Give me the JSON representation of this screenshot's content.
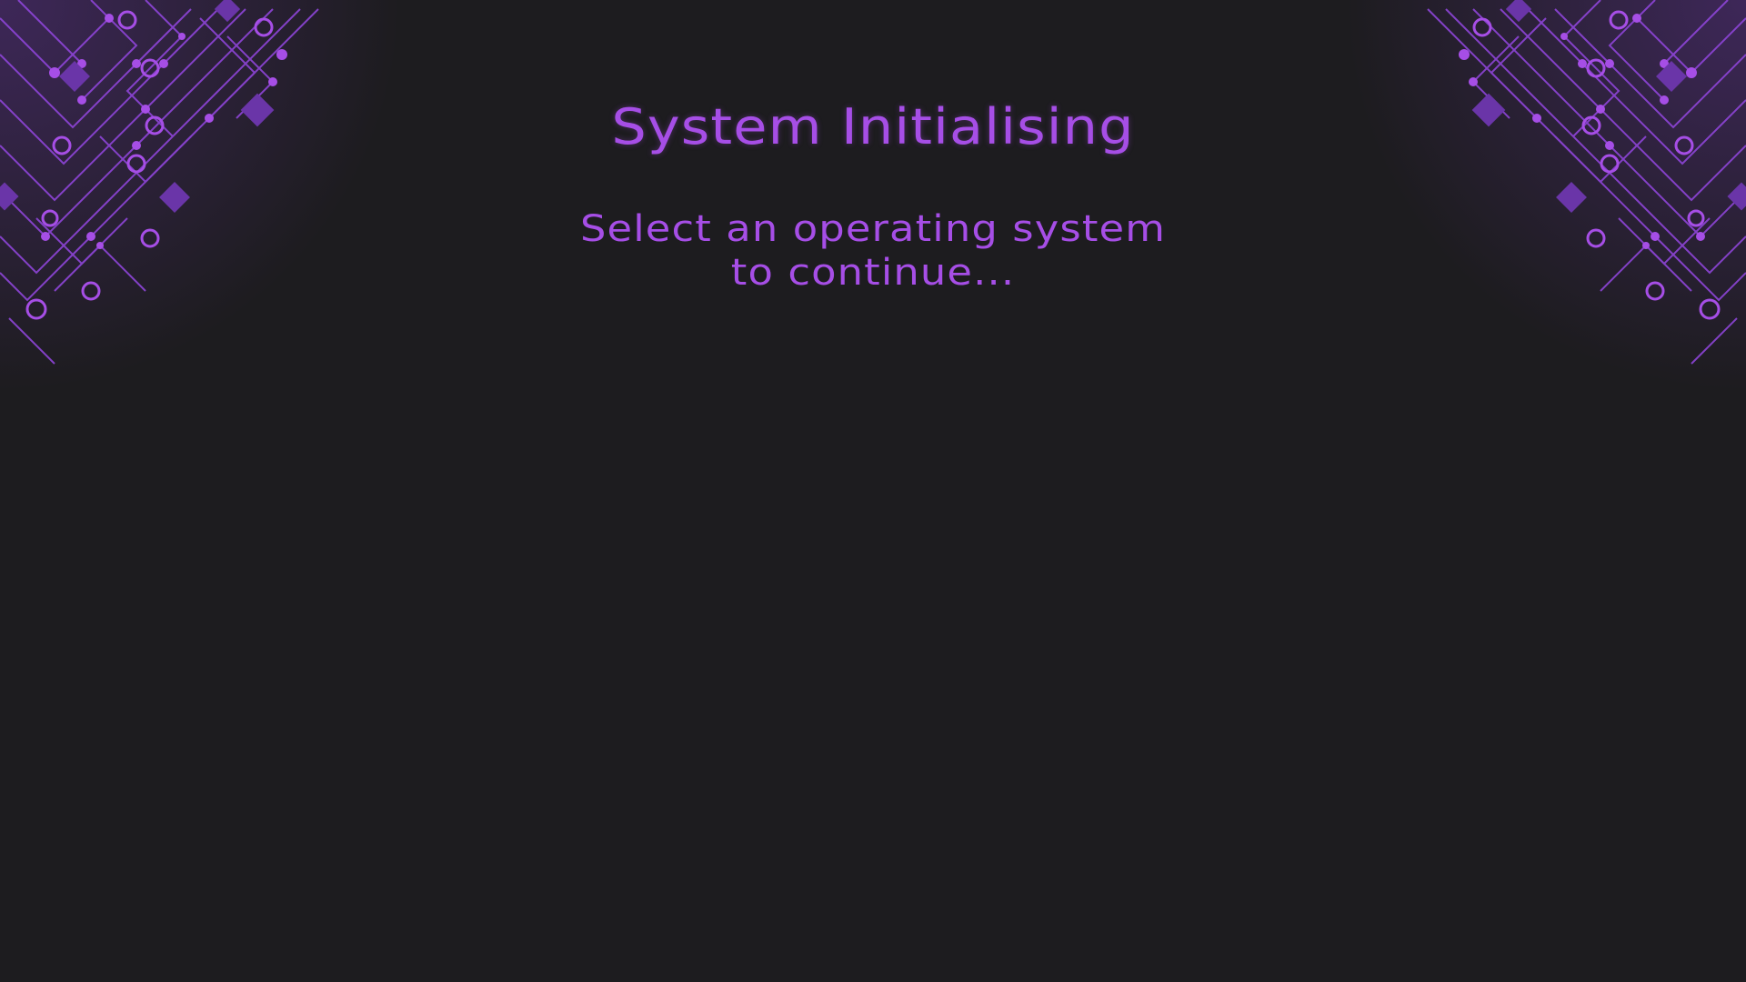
{
  "screen": {
    "title": "System Initialising",
    "subtitle_line1": "Select an operating system",
    "subtitle_line2": "to continue..."
  },
  "colors": {
    "background": "#1d1c1f",
    "accent": "#a64ee6",
    "circuit": "#7b3cc4"
  },
  "decorations": {
    "left_corner": "circuit-pattern-icon",
    "right_corner": "circuit-pattern-icon"
  }
}
